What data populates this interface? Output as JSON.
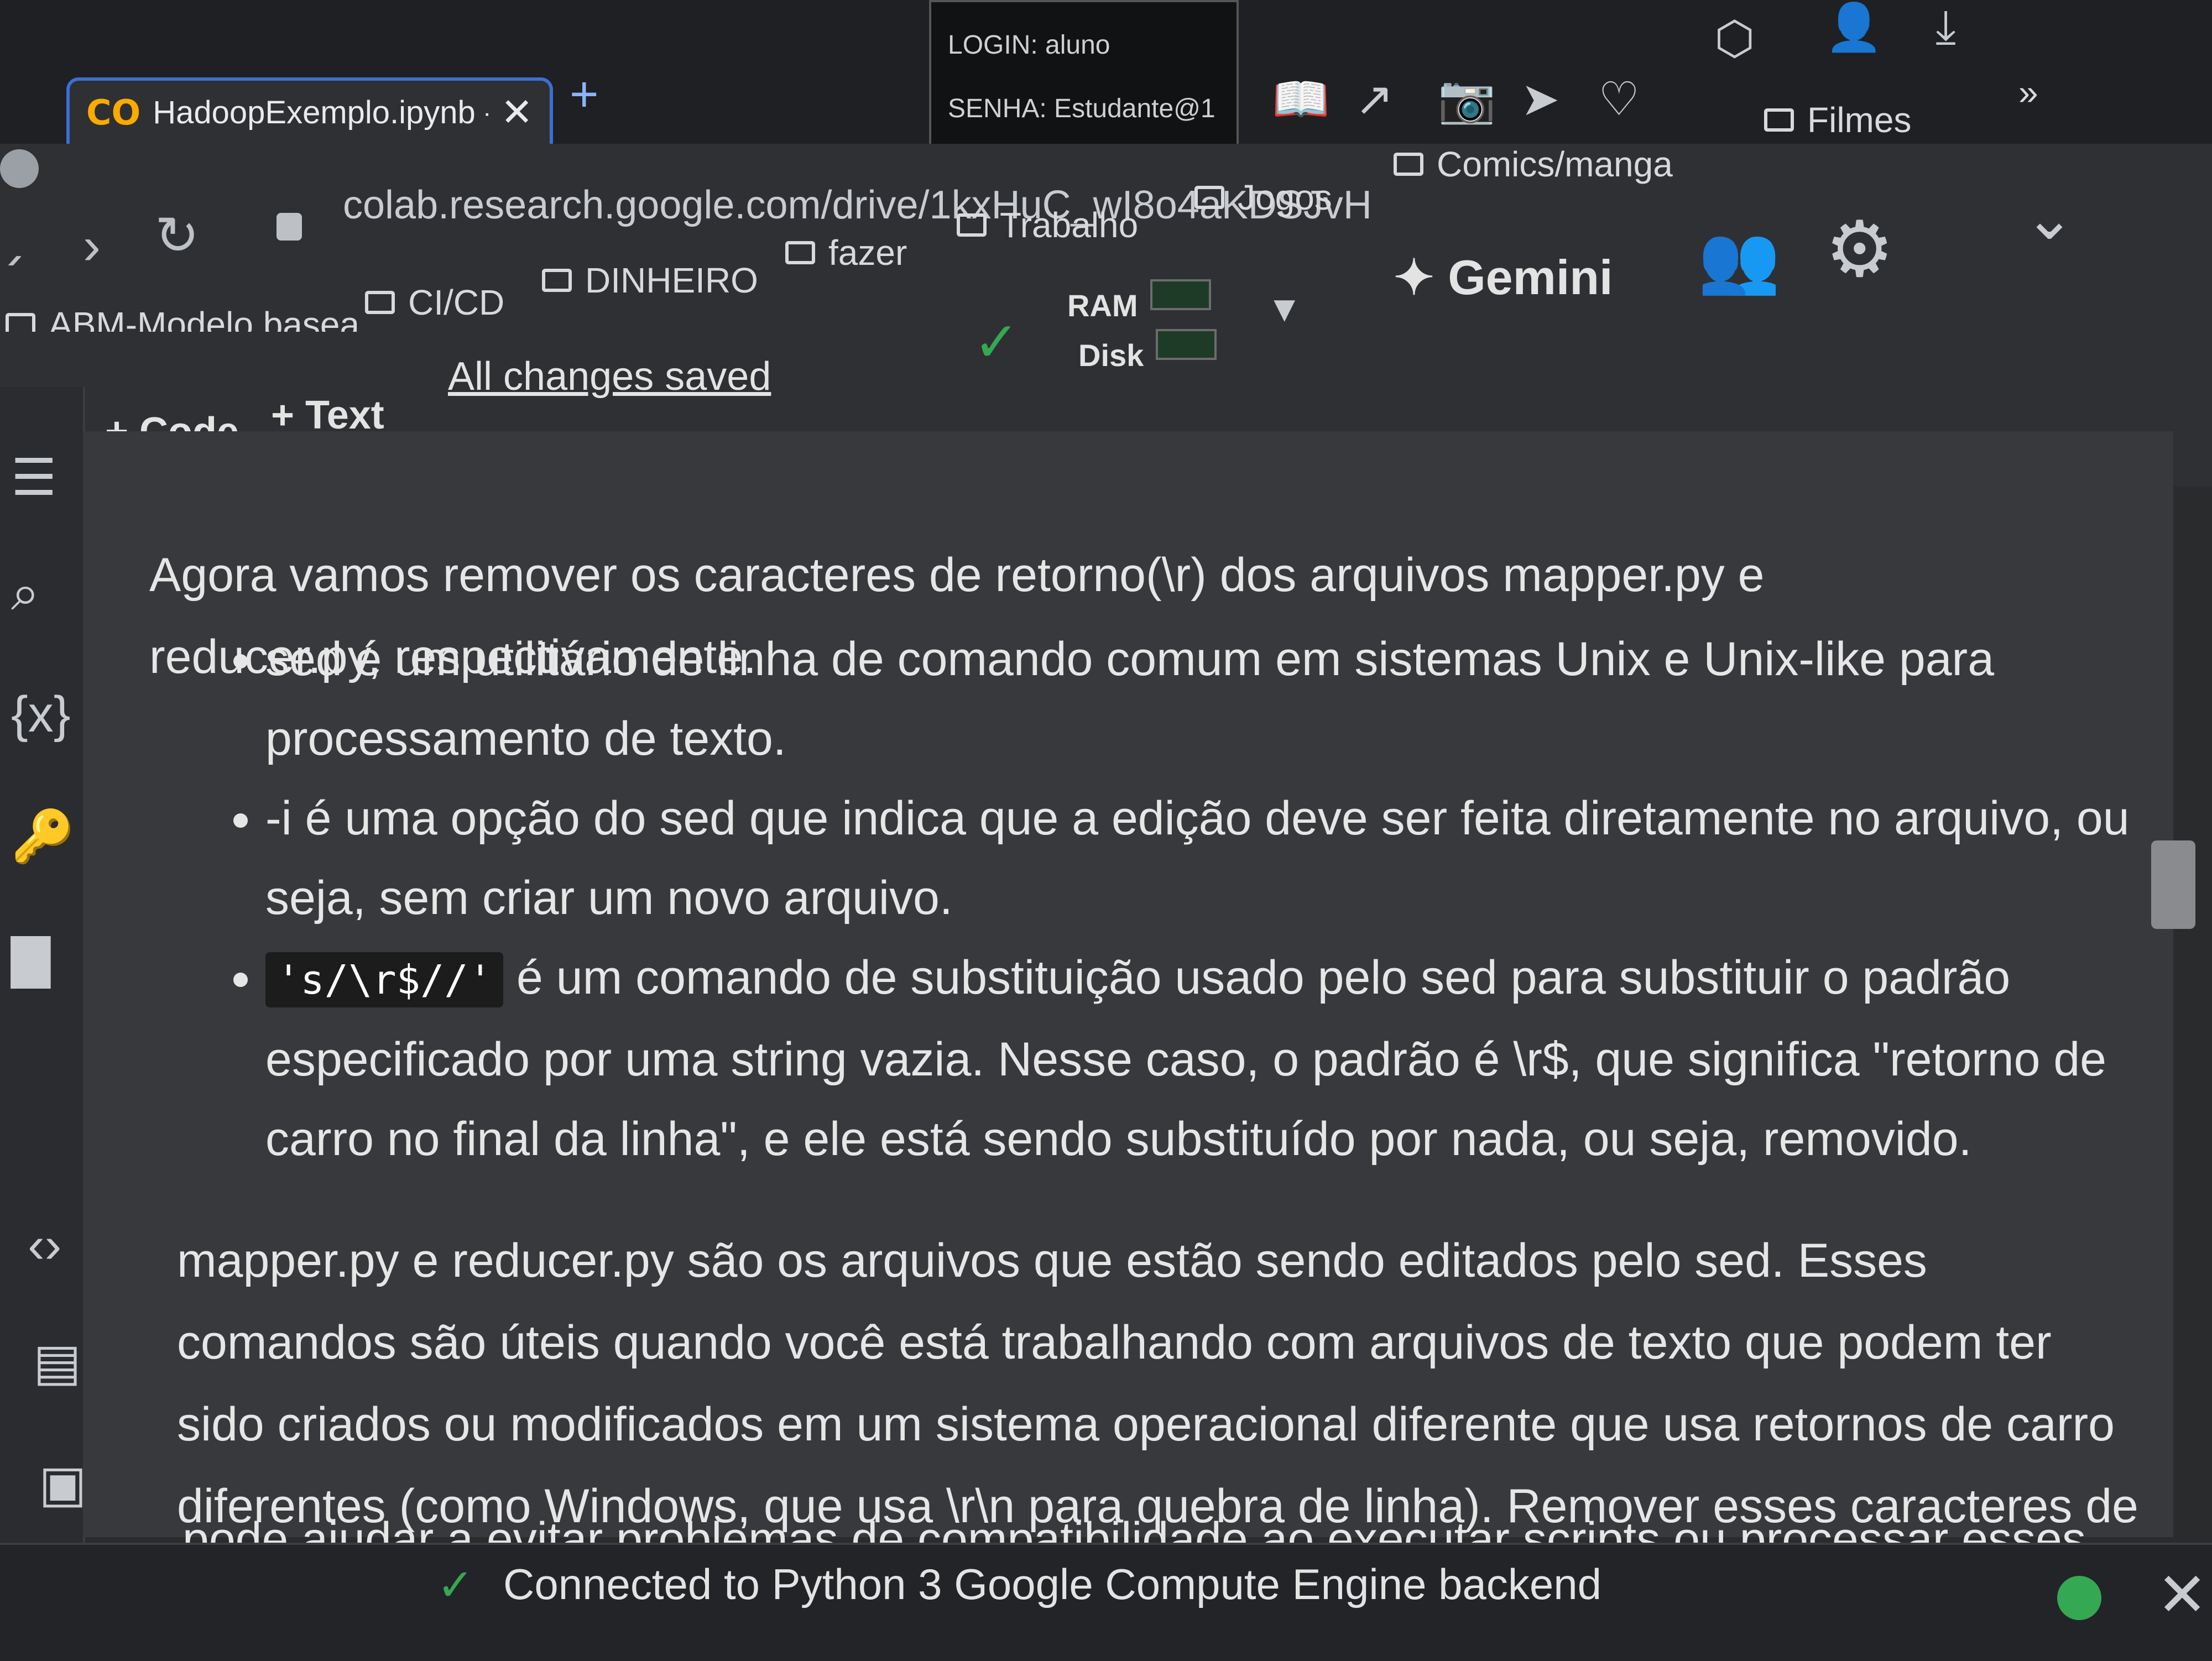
{
  "browser": {
    "tab_title": "HadoopExemplo.ipynb - Cc",
    "tab_logo": "CO",
    "new_tab": "+",
    "url": "colab.research.google.com/drive/1kxHuC_wI8o4aKDSJvH",
    "login_overlay": {
      "login": "LOGIN: aluno",
      "senha": "SENHA: Estudante@1"
    },
    "bookmarks": [
      "ABM-Modelo basea...",
      "CI/CD",
      "DINHEIRO",
      "fazer",
      "Trabalho",
      "Jogos",
      "Comics/manga",
      "Filmes"
    ],
    "more_bookmarks": "»"
  },
  "toolbar": {
    "add_code": "+ Code",
    "add_text": "+ Text",
    "save_status": "All changes saved",
    "ram_label": "RAM",
    "disk_label": "Disk",
    "gemini_label": "Gemini"
  },
  "cell": {
    "intro": "Agora vamos remover os caracteres de retorno(\\r) dos arquivos mapper.py e reducer.py, respectivamente.",
    "bullet1": "sed é um utilitário de linha de comando comum em sistemas Unix e Unix-like para processamento de texto.",
    "bullet2": "-i é uma opção do sed que indica que a edição deve ser feita diretamente no arquivo, ou seja, sem criar um novo arquivo.",
    "bullet3_code": "'s/\\r$//'",
    "bullet3_text": "é um comando de substituição usado pelo sed para substituir o padrão especificado por uma string vazia. Nesse caso, o padrão é \\r$, que significa \"retorno de carro no final da linha\", e ele está sendo substituído por nada, ou seja, removido.",
    "paragraph2": "mapper.py e reducer.py são os arquivos que estão sendo editados pelo sed. Esses comandos são úteis quando você está trabalhando com arquivos de texto que podem ter sido criados ou modificados em um sistema operacional diferente que usa retornos de carro diferentes (como Windows, que usa \\r\\n para quebra de linha). Remover esses caracteres de retorno de carro",
    "paragraph2_cut": "pode ajudar a evitar problemas de compatibilidade ao executar scripts ou processar esses"
  },
  "statusbar": {
    "text": "Connected to Python 3 Google Compute Engine backend"
  },
  "icons": {
    "check": "✓",
    "close": "✕",
    "chevron": "⌄",
    "gear": "⚙",
    "sparkle": "✦"
  }
}
